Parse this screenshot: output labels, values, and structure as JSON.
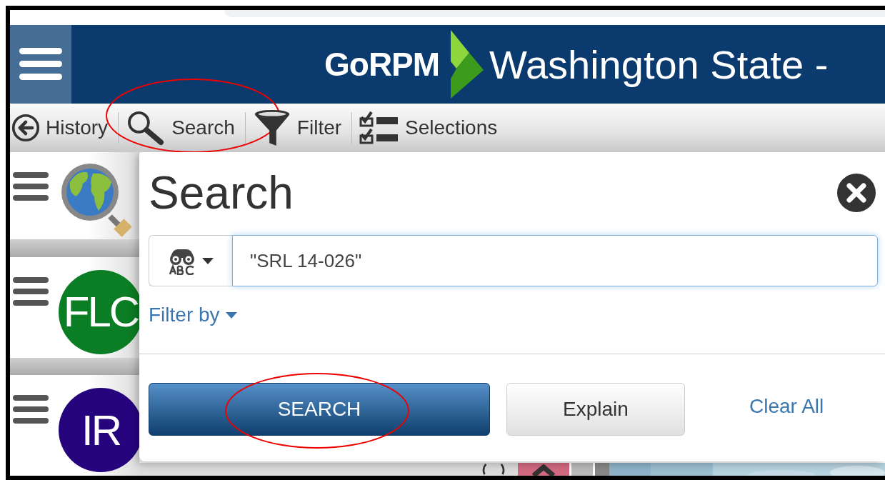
{
  "header": {
    "logo": "GoRPM",
    "title": "Washington State -"
  },
  "toolbar": [
    {
      "kind": "history",
      "label": "History",
      "circled": false
    },
    {
      "kind": "search",
      "label": "Search",
      "circled": true
    },
    {
      "kind": "filter",
      "label": "Filter",
      "circled": false
    },
    {
      "kind": "selections",
      "label": "Selections",
      "circled": false
    }
  ],
  "sidebar": [
    {
      "kind": "globe"
    },
    {
      "kind": "badge",
      "label": "FLC",
      "color": "#0b7d24"
    },
    {
      "kind": "badge",
      "label": "IR",
      "color": "#25047e"
    }
  ],
  "dialog": {
    "title": "Search",
    "query": "\"SRL 14-026\"",
    "filter_link": "Filter by",
    "buttons": [
      {
        "kind": "primary",
        "label": "SEARCH",
        "circled": true
      },
      {
        "kind": "secondary",
        "label": "Explain",
        "circled": false
      },
      {
        "kind": "link",
        "label": "Clear All",
        "circled": false
      }
    ]
  }
}
